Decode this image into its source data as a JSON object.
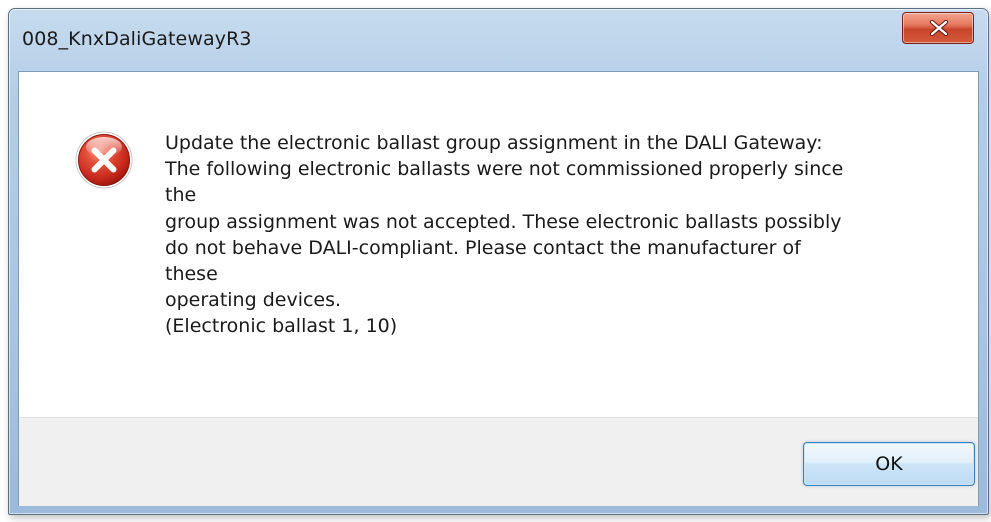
{
  "window": {
    "title": "008_KnxDaliGatewayR3"
  },
  "titlebar": {
    "close_icon": "close-x-icon"
  },
  "dialog": {
    "icon": "error-icon",
    "message_lines": [
      "Update the electronic ballast group assignment in the DALI Gateway:",
      "The following electronic ballasts were not commissioned properly since",
      "the",
      "group assignment was not accepted. These electronic ballasts possibly",
      "do not behave DALI-compliant. Please contact the manufacturer of",
      "these",
      "operating devices.",
      "(Electronic ballast 1, 10)"
    ],
    "ok_label": "OK"
  },
  "colors": {
    "error_red": "#d8352a",
    "titlebar_blue": "#b3cde6",
    "button_border": "#3c7fb1",
    "button_area": "#f0f0f0"
  }
}
